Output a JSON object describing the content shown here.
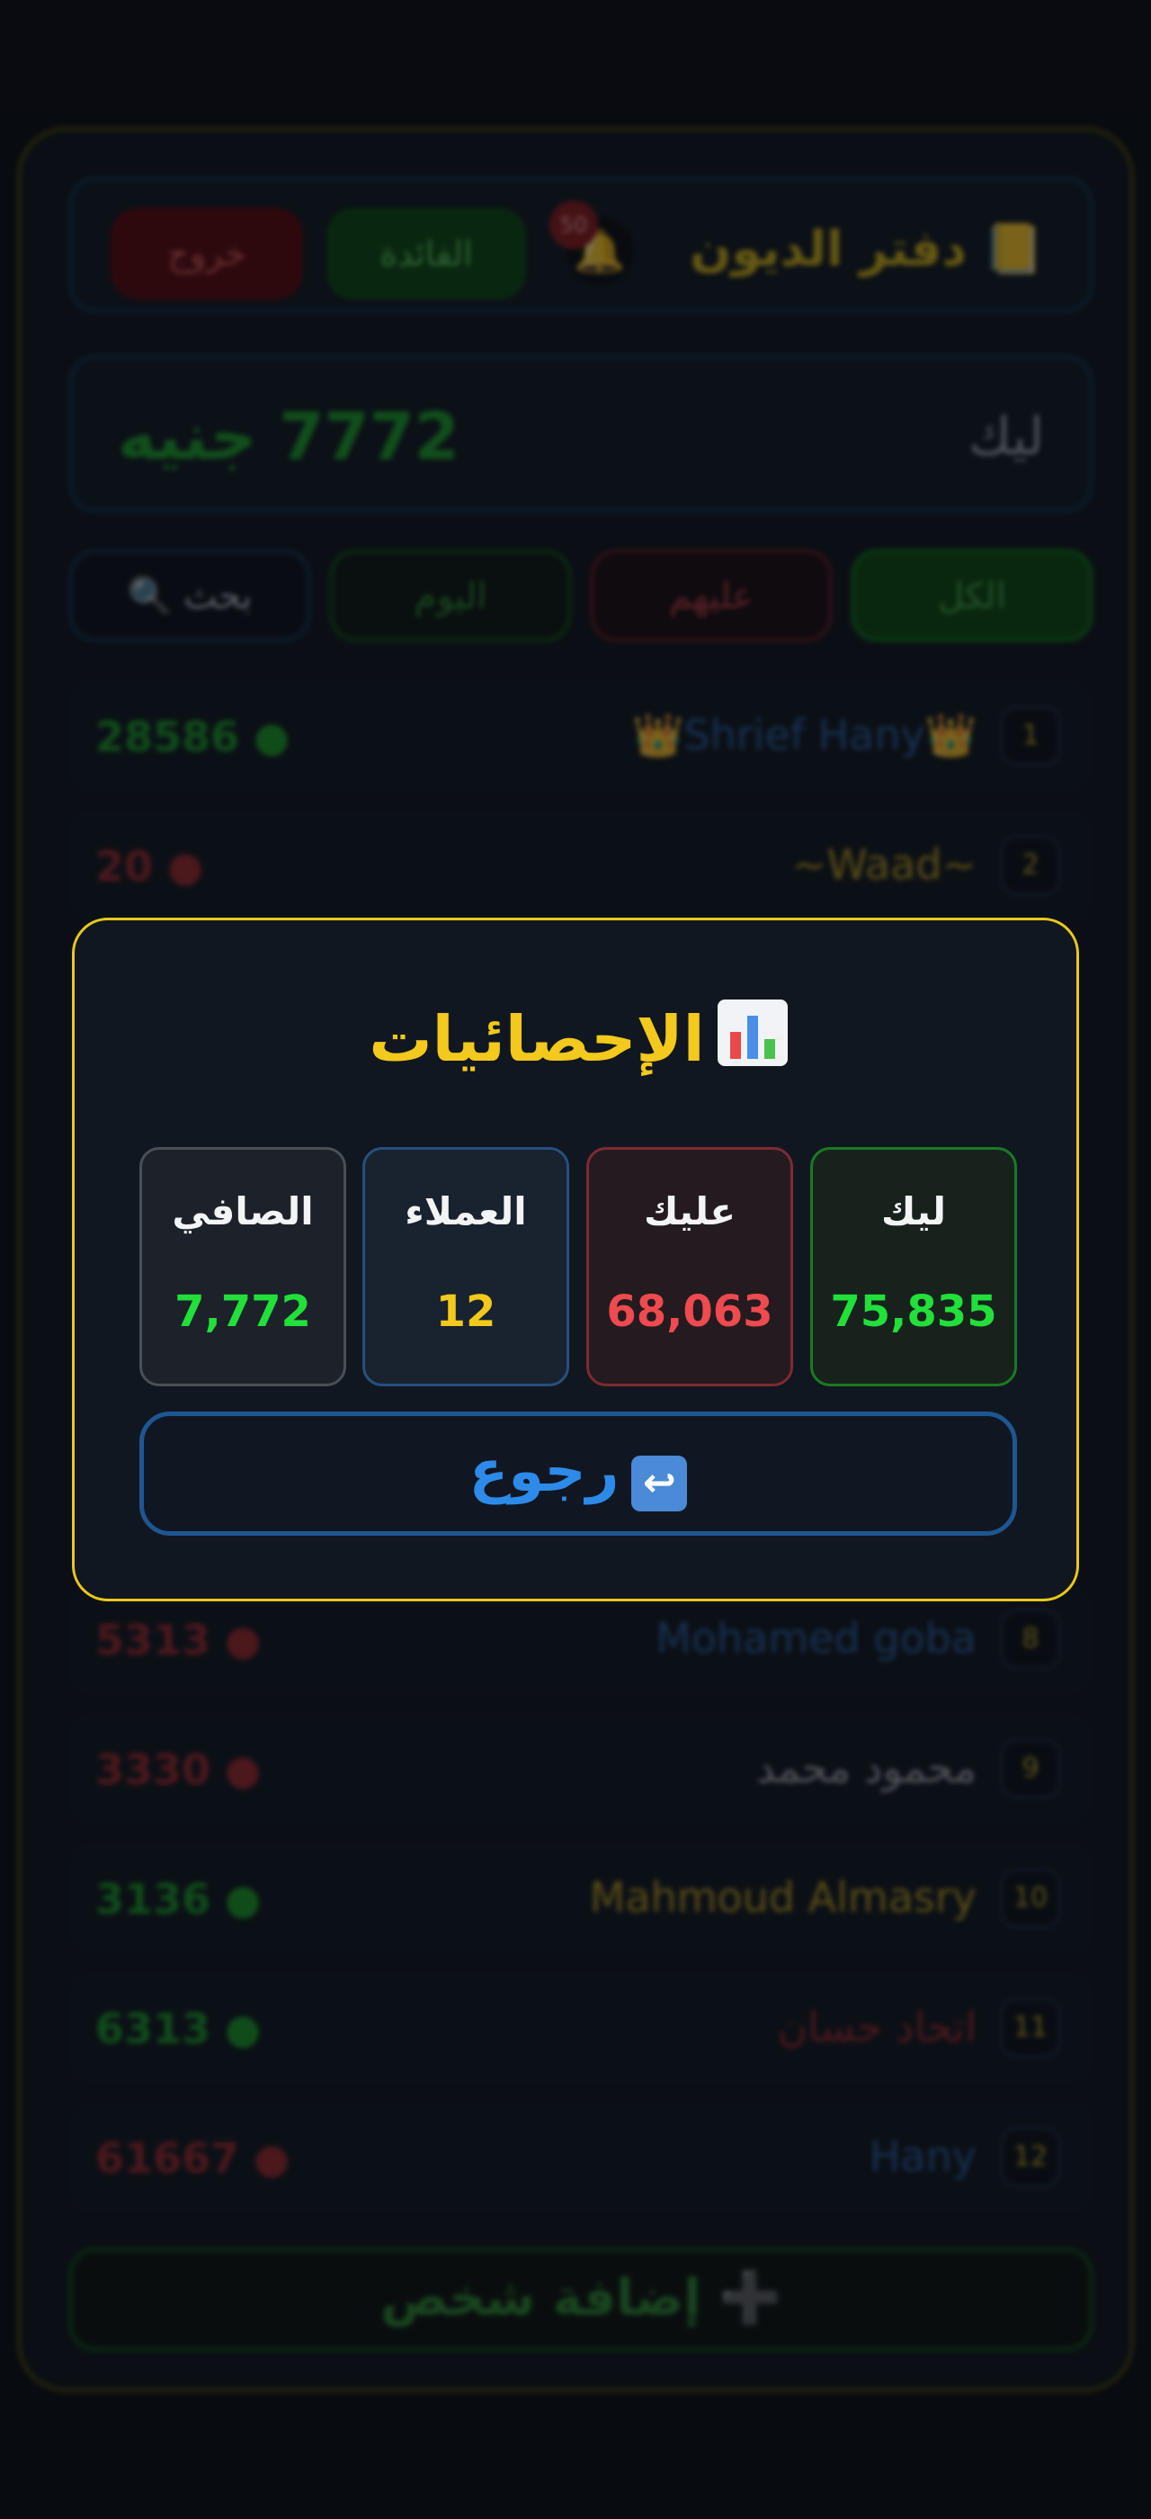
{
  "header": {
    "title": "📒 دفتر الديون",
    "notification_count": "50",
    "btn_green": "الفائدة",
    "btn_red": "خروج"
  },
  "balance": {
    "label": "ليك",
    "value": "7772 جنيه"
  },
  "filters": {
    "all": "الكل",
    "owed": "عليهم",
    "today": "اليوم",
    "search": "🔍 بحث"
  },
  "rows": [
    {
      "rank": "1",
      "name": "👑Shrief Hany👑",
      "amount": "28586 ●",
      "type": "pos"
    },
    {
      "rank": "2",
      "name": "~Waad~",
      "amount": "20 ●",
      "type": "neg"
    },
    {
      "rank": "8",
      "name": "Mohamed goba",
      "amount": "5313 ●",
      "type": "neg"
    },
    {
      "rank": "9",
      "name": "محمود محمد",
      "amount": "3330 ●",
      "type": "neg"
    },
    {
      "rank": "10",
      "name": "Mahmoud Almasry",
      "amount": "3136 ●",
      "type": "pos"
    },
    {
      "rank": "11",
      "name": "اتحاد حسان",
      "amount": "6313 ●",
      "type": "pos"
    },
    {
      "rank": "12",
      "name": "Hany",
      "amount": "61667 ●",
      "type": "neg"
    }
  ],
  "add_button": "➕ إضافة شخص",
  "modal": {
    "title": "الإحصائيات",
    "stats": {
      "lik": {
        "label": "ليك",
        "value": "75,835",
        "color": "#22e03a"
      },
      "alik": {
        "label": "عليك",
        "value": "68,063",
        "color": "#ef4a4f"
      },
      "clients": {
        "label": "العملاء",
        "value": "12",
        "color": "#f2c91c"
      },
      "net": {
        "label": "الصافي",
        "value": "7,772",
        "color": "#22e03a"
      }
    },
    "back_label": "رجوع"
  },
  "colors": {
    "accent_yellow": "#f2c91c",
    "positive_green": "#22e03a",
    "negative_red": "#ef4a4f",
    "button_blue": "#2e8ae8"
  }
}
